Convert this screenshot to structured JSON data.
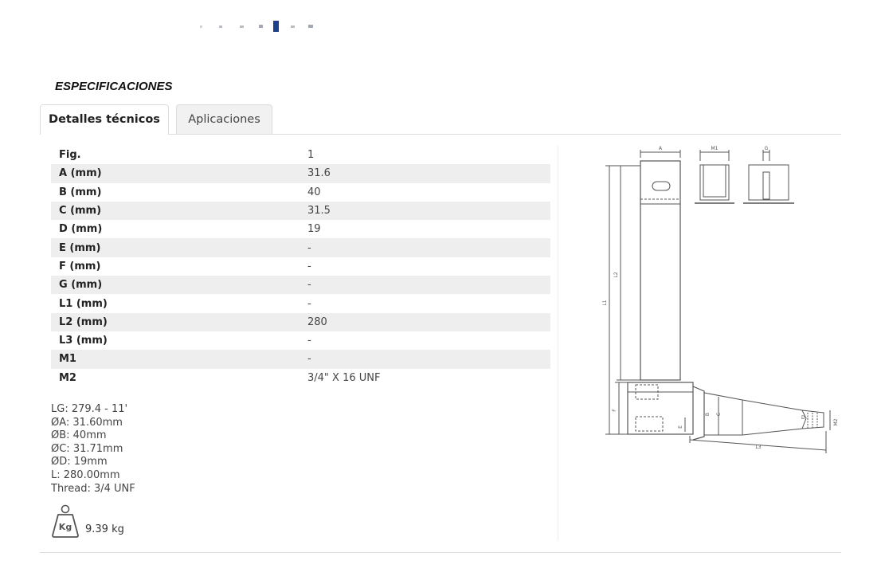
{
  "section_title": "ESPECIFICACIONES",
  "tabs": [
    {
      "label": "Detalles técnicos",
      "active": true
    },
    {
      "label": "Aplicaciones",
      "active": false
    }
  ],
  "specs": [
    {
      "key": "Fig.",
      "value": "1"
    },
    {
      "key": "A (mm)",
      "value": "31.6"
    },
    {
      "key": "B (mm)",
      "value": "40"
    },
    {
      "key": "C (mm)",
      "value": "31.5"
    },
    {
      "key": "D (mm)",
      "value": "19"
    },
    {
      "key": "E (mm)",
      "value": "-"
    },
    {
      "key": "F (mm)",
      "value": "-"
    },
    {
      "key": "G (mm)",
      "value": "-"
    },
    {
      "key": "L1 (mm)",
      "value": "-"
    },
    {
      "key": "L2 (mm)",
      "value": "280"
    },
    {
      "key": "L3 (mm)",
      "value": "-"
    },
    {
      "key": "M1",
      "value": "-"
    },
    {
      "key": "M2",
      "value": "3/4\" X 16 UNF"
    }
  ],
  "notes": [
    "LG: 279.4 - 11'",
    "ØA: 31.60mm",
    "ØB: 40mm",
    "ØC: 31.71mm",
    "ØD: 19mm",
    "L: 280.00mm",
    "Thread: 3/4 UNF"
  ],
  "weight": {
    "icon": "weight-kg-icon",
    "icon_label": "Kg",
    "value": "9.39 kg"
  },
  "drawing_labels": {
    "a": "A",
    "m1": "M1",
    "g": "G",
    "l1": "L1",
    "l2": "L2",
    "f": "F",
    "b": "B",
    "c": "C",
    "e": "E",
    "d": "D",
    "m2": "M2",
    "l3": "L3"
  },
  "colors": {
    "row_alt": "#eeeeee",
    "border": "#dcdcdc",
    "tab_inactive": "#f1f1f1",
    "drawing_line": "#555555"
  }
}
